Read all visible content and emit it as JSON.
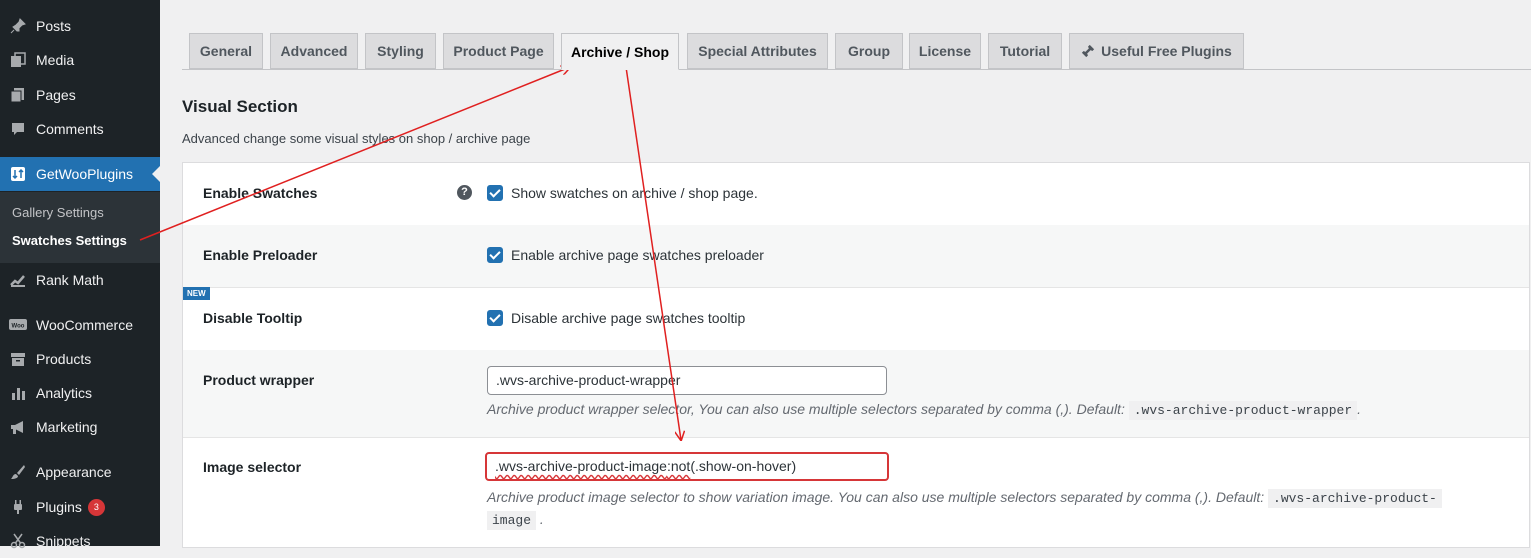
{
  "sidebar": {
    "items": [
      {
        "label": "Posts",
        "icon": "pin-icon"
      },
      {
        "label": "Media",
        "icon": "media-icon"
      },
      {
        "label": "Pages",
        "icon": "pages-icon"
      },
      {
        "label": "Comments",
        "icon": "comment-icon"
      },
      {
        "label": "GetWooPlugins",
        "icon": "getwooplugins-icon"
      },
      {
        "label": "Rank Math",
        "icon": "rank-math-icon"
      },
      {
        "label": "WooCommerce",
        "icon": "woo-icon"
      },
      {
        "label": "Products",
        "icon": "archive-icon"
      },
      {
        "label": "Analytics",
        "icon": "analytics-icon"
      },
      {
        "label": "Marketing",
        "icon": "megaphone-icon"
      },
      {
        "label": "Appearance",
        "icon": "brush-icon"
      },
      {
        "label": "Plugins",
        "icon": "plug-icon",
        "badge": "3"
      },
      {
        "label": "Snippets",
        "icon": "scissors-icon"
      }
    ],
    "submenu": [
      "Gallery Settings",
      "Swatches Settings"
    ]
  },
  "tabs": [
    "General",
    "Advanced",
    "Styling",
    "Product Page",
    "Archive / Shop",
    "Special Attributes",
    "Group",
    "License",
    "Tutorial",
    "Useful Free Plugins"
  ],
  "active_tab": "Archive / Shop",
  "section": {
    "title": "Visual Section",
    "description": "Advanced change some visual styles on shop / archive page"
  },
  "settings": {
    "enable_swatches": {
      "label": "Enable Swatches",
      "checkbox_label": "Show swatches on archive / shop page.",
      "checked": true,
      "help": "?"
    },
    "enable_preloader": {
      "label": "Enable Preloader",
      "checkbox_label": "Enable archive page swatches preloader",
      "checked": true
    },
    "disable_tooltip": {
      "label": "Disable Tooltip",
      "checkbox_label": "Disable archive page swatches tooltip",
      "checked": true,
      "badge": "NEW"
    },
    "product_wrapper": {
      "label": "Product wrapper",
      "value": ".wvs-archive-product-wrapper",
      "desc": "Archive product wrapper selector, You can also use multiple selectors separated by comma (,). Default:",
      "default_code": ".wvs-archive-product-wrapper",
      "desc_end": "."
    },
    "image_selector": {
      "label": "Image selector",
      "value_part1": ".wvs-archive-product-image",
      "value_part2": ":not",
      "value_part3": "(.show-on-hover)",
      "desc": "Archive product image selector to show variation image. You can also use multiple selectors separated by comma (,). Default:",
      "default_code_1": ".wvs-archive-product-",
      "default_code_2": "image",
      "desc_end": "."
    }
  },
  "colors": {
    "sidebar_bg": "#1d2327",
    "accent": "#2271b1",
    "annotation": "#e02020"
  }
}
